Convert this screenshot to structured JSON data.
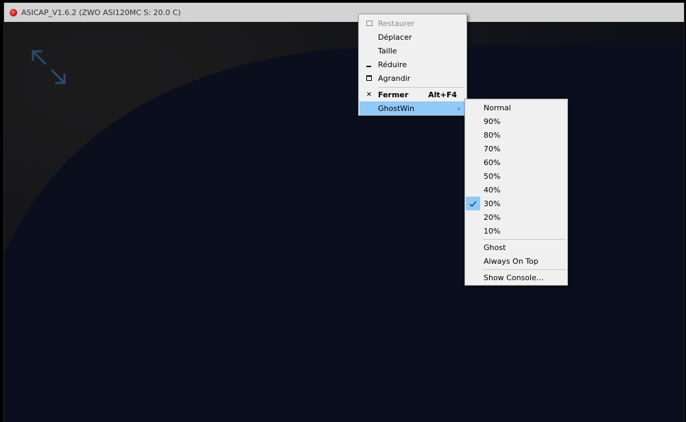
{
  "window": {
    "title": "ASICAP_V1.6.2 (ZWO ASI120MC S: 20.0 C)"
  },
  "viewport": {
    "expand_icon": "expand-arrows-icon"
  },
  "colors": {
    "highlight": "#91c9f7",
    "menu_bg": "#f0f0f0",
    "viewport_bg": "#0b0e1c"
  },
  "system_menu": {
    "items": [
      {
        "label": "Restaurer",
        "icon": "restore-icon",
        "disabled": true
      },
      {
        "label": "Déplacer"
      },
      {
        "label": "Taille"
      },
      {
        "label": "Réduire",
        "icon": "minimize-icon"
      },
      {
        "label": "Agrandir",
        "icon": "maximize-icon"
      },
      {
        "label": "Fermer",
        "icon": "close-icon",
        "shortcut": "Alt+F4",
        "bold": true
      },
      {
        "label": "GhostWin",
        "submenu": true,
        "highlighted": true
      }
    ]
  },
  "ghostwin_menu": {
    "items": [
      {
        "label": "Normal"
      },
      {
        "label": "90%"
      },
      {
        "label": "80%"
      },
      {
        "label": "70%"
      },
      {
        "label": "60%"
      },
      {
        "label": "50%"
      },
      {
        "label": "40%"
      },
      {
        "label": "30%",
        "checked": true
      },
      {
        "label": "20%"
      },
      {
        "label": "10%"
      },
      {
        "label": "Ghost"
      },
      {
        "label": "Always On Top"
      },
      {
        "label": "Show Console..."
      }
    ]
  }
}
